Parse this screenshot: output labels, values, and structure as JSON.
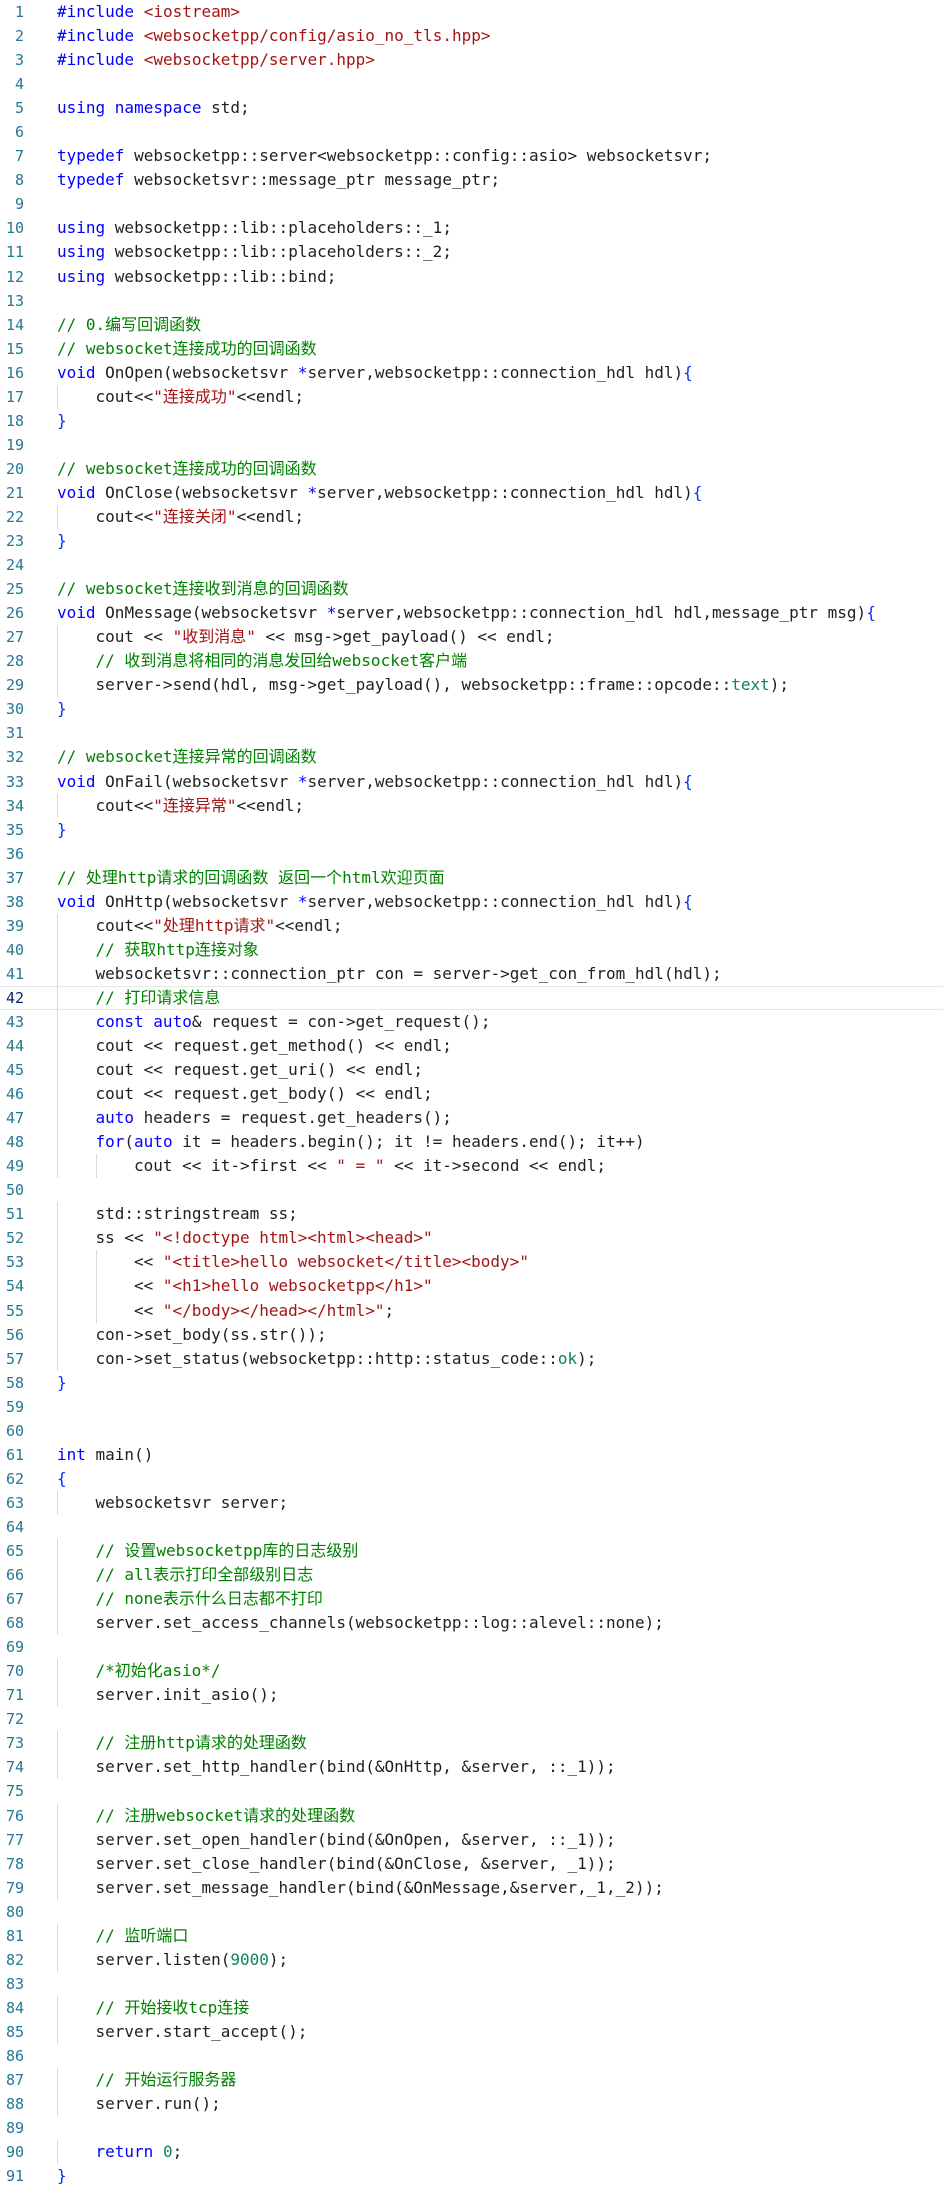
{
  "colors": {
    "background": "#ffffff",
    "line_number": "#237893",
    "keyword": "#0000ff",
    "string": "#a31515",
    "comment": "#008000",
    "number": "#098658",
    "text": "#1f1f1f"
  },
  "editor": {
    "current_line": 42,
    "lines": [
      {
        "n": "1",
        "i": 0,
        "t": [
          [
            "pp",
            "#include "
          ],
          [
            "str",
            "<iostream>"
          ]
        ]
      },
      {
        "n": "2",
        "i": 0,
        "t": [
          [
            "pp",
            "#include "
          ],
          [
            "str",
            "<websocketpp/config/asio_no_tls.hpp>"
          ]
        ]
      },
      {
        "n": "3",
        "i": 0,
        "t": [
          [
            "pp",
            "#include "
          ],
          [
            "str",
            "<websocketpp/server.hpp>"
          ]
        ]
      },
      {
        "n": "4",
        "i": 0,
        "t": []
      },
      {
        "n": "5",
        "i": 0,
        "t": [
          [
            "kw",
            "using namespace "
          ],
          [
            "pl",
            "std;"
          ]
        ]
      },
      {
        "n": "6",
        "i": 0,
        "t": []
      },
      {
        "n": "7",
        "i": 0,
        "t": [
          [
            "kw",
            "typedef "
          ],
          [
            "pl",
            "websocketpp::server<websocketpp::config::asio> websocketsvr;"
          ]
        ]
      },
      {
        "n": "8",
        "i": 0,
        "t": [
          [
            "kw",
            "typedef "
          ],
          [
            "pl",
            "websocketsvr::message_ptr message_ptr;"
          ]
        ]
      },
      {
        "n": "9",
        "i": 0,
        "t": []
      },
      {
        "n": "10",
        "i": 0,
        "t": [
          [
            "kw",
            "using "
          ],
          [
            "pl",
            "websocketpp::lib::placeholders::_1;"
          ]
        ]
      },
      {
        "n": "11",
        "i": 0,
        "t": [
          [
            "kw",
            "using "
          ],
          [
            "pl",
            "websocketpp::lib::placeholders::_2;"
          ]
        ]
      },
      {
        "n": "12",
        "i": 0,
        "t": [
          [
            "kw",
            "using "
          ],
          [
            "pl",
            "websocketpp::lib::bind;"
          ]
        ]
      },
      {
        "n": "13",
        "i": 0,
        "t": []
      },
      {
        "n": "14",
        "i": 0,
        "t": [
          [
            "com",
            "// 0.编写回调函数"
          ]
        ]
      },
      {
        "n": "15",
        "i": 0,
        "t": [
          [
            "com",
            "// websocket连接成功的回调函数"
          ]
        ]
      },
      {
        "n": "16",
        "i": 0,
        "t": [
          [
            "kw",
            "void "
          ],
          [
            "pl",
            "OnOpen(websocketsvr "
          ],
          [
            "kw",
            "*"
          ],
          [
            "pl",
            "server,websocketpp::connection_hdl hdl)"
          ],
          [
            "br",
            "{"
          ]
        ]
      },
      {
        "n": "17",
        "i": 1,
        "t": [
          [
            "pl",
            "cout<<"
          ],
          [
            "str",
            "\"连接成功\""
          ],
          [
            "pl",
            "<<endl;"
          ]
        ]
      },
      {
        "n": "18",
        "i": 0,
        "t": [
          [
            "br",
            "}"
          ]
        ]
      },
      {
        "n": "19",
        "i": 0,
        "t": []
      },
      {
        "n": "20",
        "i": 0,
        "t": [
          [
            "com",
            "// websocket连接成功的回调函数"
          ]
        ]
      },
      {
        "n": "21",
        "i": 0,
        "t": [
          [
            "kw",
            "void "
          ],
          [
            "pl",
            "OnClose(websocketsvr "
          ],
          [
            "kw",
            "*"
          ],
          [
            "pl",
            "server,websocketpp::connection_hdl hdl)"
          ],
          [
            "br",
            "{"
          ]
        ]
      },
      {
        "n": "22",
        "i": 1,
        "t": [
          [
            "pl",
            "cout<<"
          ],
          [
            "str",
            "\"连接关闭\""
          ],
          [
            "pl",
            "<<endl;"
          ]
        ]
      },
      {
        "n": "23",
        "i": 0,
        "t": [
          [
            "br",
            "}"
          ]
        ]
      },
      {
        "n": "24",
        "i": 0,
        "t": []
      },
      {
        "n": "25",
        "i": 0,
        "t": [
          [
            "com",
            "// websocket连接收到消息的回调函数"
          ]
        ]
      },
      {
        "n": "26",
        "i": 0,
        "t": [
          [
            "kw",
            "void "
          ],
          [
            "pl",
            "OnMessage(websocketsvr "
          ],
          [
            "kw",
            "*"
          ],
          [
            "pl",
            "server,websocketpp::connection_hdl hdl,message_ptr msg)"
          ],
          [
            "br",
            "{"
          ]
        ]
      },
      {
        "n": "27",
        "i": 1,
        "t": [
          [
            "pl",
            "cout << "
          ],
          [
            "str",
            "\"收到消息\""
          ],
          [
            "pl",
            " << msg->get_payload() << endl;"
          ]
        ]
      },
      {
        "n": "28",
        "i": 1,
        "t": [
          [
            "com",
            "// 收到消息将相同的消息发回给websocket客户端"
          ]
        ]
      },
      {
        "n": "29",
        "i": 1,
        "t": [
          [
            "pl",
            "server->send(hdl, msg->get_payload(), websocketpp::frame::opcode::"
          ],
          [
            "num",
            "text"
          ],
          [
            "pl",
            ");"
          ]
        ]
      },
      {
        "n": "30",
        "i": 0,
        "t": [
          [
            "br",
            "}"
          ]
        ]
      },
      {
        "n": "31",
        "i": 0,
        "t": []
      },
      {
        "n": "32",
        "i": 0,
        "t": [
          [
            "com",
            "// websocket连接异常的回调函数"
          ]
        ]
      },
      {
        "n": "33",
        "i": 0,
        "t": [
          [
            "kw",
            "void "
          ],
          [
            "pl",
            "OnFail(websocketsvr "
          ],
          [
            "kw",
            "*"
          ],
          [
            "pl",
            "server,websocketpp::connection_hdl hdl)"
          ],
          [
            "br",
            "{"
          ]
        ]
      },
      {
        "n": "34",
        "i": 1,
        "t": [
          [
            "pl",
            "cout<<"
          ],
          [
            "str",
            "\"连接异常\""
          ],
          [
            "pl",
            "<<endl;"
          ]
        ]
      },
      {
        "n": "35",
        "i": 0,
        "t": [
          [
            "br",
            "}"
          ]
        ]
      },
      {
        "n": "36",
        "i": 0,
        "t": []
      },
      {
        "n": "37",
        "i": 0,
        "t": [
          [
            "com",
            "// 处理http请求的回调函数 返回一个html欢迎页面"
          ]
        ]
      },
      {
        "n": "38",
        "i": 0,
        "t": [
          [
            "kw",
            "void "
          ],
          [
            "pl",
            "OnHttp(websocketsvr "
          ],
          [
            "kw",
            "*"
          ],
          [
            "pl",
            "server,websocketpp::connection_hdl hdl)"
          ],
          [
            "br",
            "{"
          ]
        ]
      },
      {
        "n": "39",
        "i": 1,
        "t": [
          [
            "pl",
            "cout<<"
          ],
          [
            "str",
            "\"处理http请求\""
          ],
          [
            "pl",
            "<<endl;"
          ]
        ]
      },
      {
        "n": "40",
        "i": 1,
        "t": [
          [
            "com",
            "// 获取http连接对象"
          ]
        ]
      },
      {
        "n": "41",
        "i": 1,
        "t": [
          [
            "pl",
            "websocketsvr::connection_ptr con = server->get_con_from_hdl(hdl);"
          ]
        ]
      },
      {
        "n": "42",
        "i": 1,
        "t": [
          [
            "com",
            "// 打印请求信息"
          ]
        ]
      },
      {
        "n": "43",
        "i": 1,
        "t": [
          [
            "kw",
            "const auto"
          ],
          [
            "pl",
            "& request = con->get_request();"
          ]
        ]
      },
      {
        "n": "44",
        "i": 1,
        "t": [
          [
            "pl",
            "cout << request.get_method() << endl;"
          ]
        ]
      },
      {
        "n": "45",
        "i": 1,
        "t": [
          [
            "pl",
            "cout << request.get_uri() << endl;"
          ]
        ]
      },
      {
        "n": "46",
        "i": 1,
        "t": [
          [
            "pl",
            "cout << request.get_body() << endl;"
          ]
        ]
      },
      {
        "n": "47",
        "i": 1,
        "t": [
          [
            "kw",
            "auto "
          ],
          [
            "pl",
            "headers = request.get_headers();"
          ]
        ]
      },
      {
        "n": "48",
        "i": 1,
        "t": [
          [
            "kw",
            "for"
          ],
          [
            "pl",
            "("
          ],
          [
            "kw",
            "auto "
          ],
          [
            "pl",
            "it = headers.begin(); it != headers.end(); it++)"
          ]
        ]
      },
      {
        "n": "49",
        "i": 2,
        "t": [
          [
            "pl",
            "cout << it->first << "
          ],
          [
            "str",
            "\" = \""
          ],
          [
            "pl",
            " << it->second << endl;"
          ]
        ]
      },
      {
        "n": "50",
        "i": 0,
        "t": []
      },
      {
        "n": "51",
        "i": 1,
        "t": [
          [
            "pl",
            "std::stringstream ss;"
          ]
        ]
      },
      {
        "n": "52",
        "i": 1,
        "t": [
          [
            "pl",
            "ss << "
          ],
          [
            "str",
            "\"<!doctype html><html><head>\""
          ]
        ]
      },
      {
        "n": "53",
        "i": 2,
        "t": [
          [
            "pl",
            "<< "
          ],
          [
            "str",
            "\"<title>hello websocket</title><body>\""
          ]
        ]
      },
      {
        "n": "54",
        "i": 2,
        "t": [
          [
            "pl",
            "<< "
          ],
          [
            "str",
            "\"<h1>hello websocketpp</h1>\""
          ]
        ]
      },
      {
        "n": "55",
        "i": 2,
        "t": [
          [
            "pl",
            "<< "
          ],
          [
            "str",
            "\"</body></head></html>\""
          ],
          [
            "pl",
            ";"
          ]
        ]
      },
      {
        "n": "56",
        "i": 1,
        "t": [
          [
            "pl",
            "con->set_body(ss.str());"
          ]
        ]
      },
      {
        "n": "57",
        "i": 1,
        "t": [
          [
            "pl",
            "con->set_status(websocketpp::http::status_code::"
          ],
          [
            "num",
            "ok"
          ],
          [
            "pl",
            ");"
          ]
        ]
      },
      {
        "n": "58",
        "i": 0,
        "t": [
          [
            "br",
            "}"
          ]
        ]
      },
      {
        "n": "59",
        "i": 0,
        "t": []
      },
      {
        "n": "60",
        "i": 0,
        "t": []
      },
      {
        "n": "61",
        "i": 0,
        "t": [
          [
            "kw",
            "int "
          ],
          [
            "pl",
            "main()"
          ]
        ]
      },
      {
        "n": "62",
        "i": 0,
        "t": [
          [
            "br",
            "{"
          ]
        ]
      },
      {
        "n": "63",
        "i": 1,
        "t": [
          [
            "pl",
            "websocketsvr server;"
          ]
        ]
      },
      {
        "n": "64",
        "i": 0,
        "t": []
      },
      {
        "n": "65",
        "i": 1,
        "t": [
          [
            "com",
            "// 设置websocketpp库的日志级别"
          ]
        ]
      },
      {
        "n": "66",
        "i": 1,
        "t": [
          [
            "com",
            "// all表示打印全部级别日志"
          ]
        ]
      },
      {
        "n": "67",
        "i": 1,
        "t": [
          [
            "com",
            "// none表示什么日志都不打印"
          ]
        ]
      },
      {
        "n": "68",
        "i": 1,
        "t": [
          [
            "pl",
            "server.set_access_channels(websocketpp::log::alevel::none);"
          ]
        ]
      },
      {
        "n": "69",
        "i": 0,
        "t": []
      },
      {
        "n": "70",
        "i": 1,
        "t": [
          [
            "com",
            "/*初始化asio*/"
          ]
        ]
      },
      {
        "n": "71",
        "i": 1,
        "t": [
          [
            "pl",
            "server.init_asio();"
          ]
        ]
      },
      {
        "n": "72",
        "i": 0,
        "t": []
      },
      {
        "n": "73",
        "i": 1,
        "t": [
          [
            "com",
            "// 注册http请求的处理函数"
          ]
        ]
      },
      {
        "n": "74",
        "i": 1,
        "t": [
          [
            "pl",
            "server.set_http_handler(bind(&OnHttp, &server, ::_1));"
          ]
        ]
      },
      {
        "n": "75",
        "i": 0,
        "t": []
      },
      {
        "n": "76",
        "i": 1,
        "t": [
          [
            "com",
            "// 注册websocket请求的处理函数"
          ]
        ]
      },
      {
        "n": "77",
        "i": 1,
        "t": [
          [
            "pl",
            "server.set_open_handler(bind(&OnOpen, &server, ::_1));"
          ]
        ]
      },
      {
        "n": "78",
        "i": 1,
        "t": [
          [
            "pl",
            "server.set_close_handler(bind(&OnClose, &server, _1));"
          ]
        ]
      },
      {
        "n": "79",
        "i": 1,
        "t": [
          [
            "pl",
            "server.set_message_handler(bind(&OnMessage,&server,_1,_2));"
          ]
        ]
      },
      {
        "n": "80",
        "i": 0,
        "t": []
      },
      {
        "n": "81",
        "i": 1,
        "t": [
          [
            "com",
            "// 监听端口"
          ]
        ]
      },
      {
        "n": "82",
        "i": 1,
        "t": [
          [
            "pl",
            "server.listen("
          ],
          [
            "num",
            "9000"
          ],
          [
            "pl",
            ");"
          ]
        ]
      },
      {
        "n": "83",
        "i": 0,
        "t": []
      },
      {
        "n": "84",
        "i": 1,
        "t": [
          [
            "com",
            "// 开始接收tcp连接"
          ]
        ]
      },
      {
        "n": "85",
        "i": 1,
        "t": [
          [
            "pl",
            "server.start_accept();"
          ]
        ]
      },
      {
        "n": "86",
        "i": 0,
        "t": []
      },
      {
        "n": "87",
        "i": 1,
        "t": [
          [
            "com",
            "// 开始运行服务器"
          ]
        ]
      },
      {
        "n": "88",
        "i": 1,
        "t": [
          [
            "pl",
            "server.run();"
          ]
        ]
      },
      {
        "n": "89",
        "i": 0,
        "t": []
      },
      {
        "n": "90",
        "i": 1,
        "t": [
          [
            "kw",
            "return "
          ],
          [
            "num",
            "0"
          ],
          [
            "pl",
            ";"
          ]
        ]
      },
      {
        "n": "91",
        "i": 0,
        "t": [
          [
            "br",
            "}"
          ]
        ]
      }
    ]
  }
}
